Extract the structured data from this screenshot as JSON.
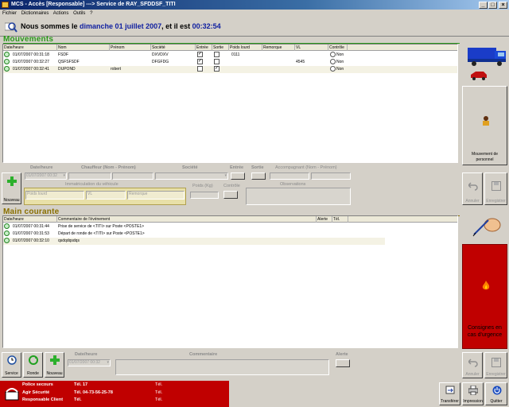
{
  "window": {
    "title": "MCS - Accès [Responsable]   ---> Service de RAY_SFDDSF_TITI"
  },
  "menu": [
    "Fichier",
    "Dictionnaires",
    "Actions",
    "Outils",
    "?"
  ],
  "header": {
    "prefix": "Nous sommes le",
    "date": "dimanche 01 juillet 2007",
    "middle": ", et il est",
    "time": "00:32:54"
  },
  "mouvements": {
    "title": "Mouvements",
    "columns": [
      "Date/heure",
      "Nom",
      "Prénom",
      "Société",
      "Entrée",
      "Sortie",
      "Poids lourd",
      "Remorque",
      "VL",
      "Contrôle"
    ],
    "rows": [
      {
        "date": "01/07/2007 00:31:18",
        "nom": "FSDF",
        "prenom": "",
        "societe": "DXVDXV",
        "entree": "✓",
        "sortie": "",
        "poids": "0111",
        "remorque": "",
        "vl": "",
        "controle": "Non"
      },
      {
        "date": "01/07/2007 00:32:27",
        "nom": "QSFSFSDF",
        "prenom": "",
        "societe": "DFGFDG",
        "entree": "✓",
        "sortie": "",
        "poids": "",
        "remorque": "",
        "vl": "4545",
        "controle": "Non"
      },
      {
        "date": "01/07/2007 00:32:41",
        "nom": "DUPOND",
        "prenom": "robert",
        "societe": "",
        "entree": "",
        "sortie": "✓",
        "poids": "",
        "remorque": "",
        "vl": "",
        "controle": "Non"
      }
    ]
  },
  "form1": {
    "labels": {
      "date": "Date/heure",
      "chauffeur": "Chauffeur (Nom - Prénom)",
      "societe": "Société",
      "entree": "Entrée",
      "sortie": "Sortie",
      "accompagnant": "Accompagnant (Nom - Prénom)",
      "immat": "Immatriculation du véhicule",
      "poids_kg": "Poids (Kg)",
      "controle": "Contrôle",
      "observations": "Observations"
    },
    "date_value": "01/07/2007 00:32",
    "placeholders": {
      "poids_lourd": "Poids lourd",
      "vl": "VL",
      "remorque": "Remorque"
    },
    "nouveau": "Nouveau"
  },
  "right_panel": {
    "mouvement_personnel": "Mouvement de personnel",
    "annuler": "Annuler",
    "enregistrer": "Enregistrer"
  },
  "main_courante": {
    "title": "Main courante",
    "columns": [
      "Date/heure",
      "Commentaire de l'événement",
      "Alerte",
      "Tél."
    ],
    "rows": [
      {
        "date": "01/07/2007 00:31:44",
        "comment": "Prise de service de <TITI> sur Poste <POSTE1>"
      },
      {
        "date": "01/07/2007 00:31:53",
        "comment": "Départ de ronde de <TITI> sur Poste <POSTE1>"
      },
      {
        "date": "01/07/2007 00:32:10",
        "comment": "qsdqdqsdqs"
      }
    ],
    "consignes": "Consignes en cas d'urgence"
  },
  "form2": {
    "buttons": [
      "Service",
      "Ronde",
      "Nouveau"
    ],
    "labels": {
      "date": "Date/heure",
      "commentaire": "Commentaire",
      "alerte": "Alerte"
    },
    "date_value": "01/07/2007 00:32",
    "annuler": "Annuler",
    "enregistrer": "Enregistrer"
  },
  "emergency": [
    {
      "label": "Police secours",
      "tel": "Tél. 17",
      "tel2": "Tél."
    },
    {
      "label": "Agir Sécurité",
      "tel": "Tél. 04-73-56-25-78",
      "tel2": "Tél."
    },
    {
      "label": "Responsable Client",
      "tel": "Tél.",
      "tel2": "Tél."
    }
  ],
  "footer_buttons": [
    "Transférer",
    "Impression",
    "Quitter"
  ]
}
